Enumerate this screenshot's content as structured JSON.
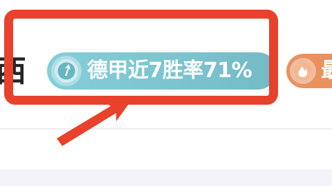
{
  "header": {
    "title_fragment": "西"
  },
  "tags": {
    "winrate_tag": {
      "label": "德甲近7胜率71%",
      "icon": "up-arrow-icon",
      "color": "#7cc4cf"
    },
    "hot_tag": {
      "label": "最",
      "icon": "flame-icon",
      "color": "#e9915f"
    }
  },
  "annotation": {
    "highlight_color": "#e8412c"
  }
}
